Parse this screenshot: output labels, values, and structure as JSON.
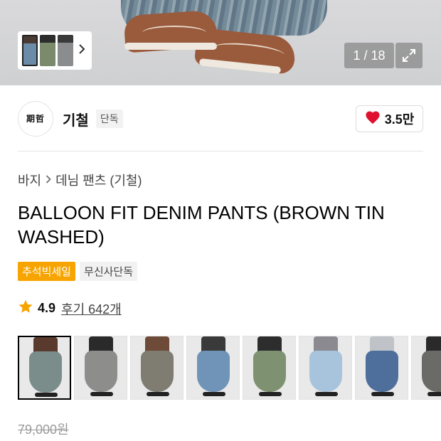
{
  "hero": {
    "counter": "1 / 18",
    "thumbnails": [
      "thumb-1",
      "thumb-2",
      "thumb-3"
    ],
    "next_icon": "chevron-right-icon",
    "expand_icon": "expand-icon"
  },
  "brand": {
    "logo_text": "期哲",
    "logo_subtext": "",
    "name": "기철",
    "badge": "단독",
    "likes": "3.5만",
    "like_icon": "heart-icon",
    "like_color": "#e0102f"
  },
  "breadcrumb": {
    "items": [
      "바지",
      "데님 팬츠 (기철)"
    ],
    "separator_icon": "chevron-right-icon"
  },
  "product": {
    "title": "BALLOON FIT DENIM PANTS (BROWN TIN WASHED)",
    "tags": [
      "추석빅세일",
      "무신사단독"
    ],
    "tag_colors": {
      "sale": "#f7a400"
    },
    "rating": "4.9",
    "reviews": "후기 642개",
    "star_color": "#f7a400",
    "original_price": "79,000원"
  },
  "gallery": {
    "items": [
      {
        "top": "#5a3a2c",
        "pants": "#7b8d8a"
      },
      {
        "top": "#2a2a2a",
        "pants": "#8d8e8c"
      },
      {
        "top": "#6e4a38",
        "pants": "#7f7c72"
      },
      {
        "top": "#3a3a3a",
        "pants": "#6f94b8"
      },
      {
        "top": "#2d2d2d",
        "pants": "#7e9170"
      },
      {
        "top": "#8a8a90",
        "pants": "#a8c3dc"
      },
      {
        "top": "#bfc3c7",
        "pants": "#4e6f9b"
      },
      {
        "top": "#2a2a2a",
        "pants": "#6a6a66"
      }
    ]
  }
}
